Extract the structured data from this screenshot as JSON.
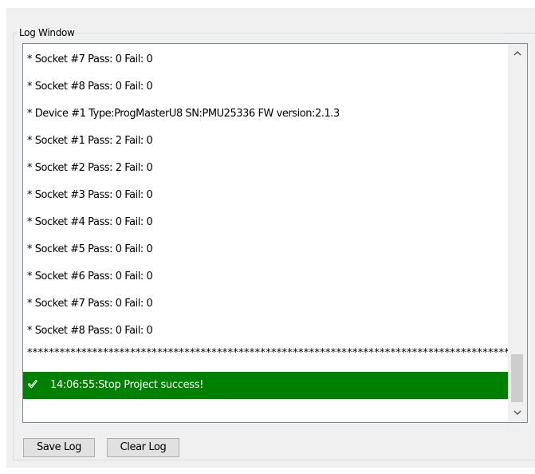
{
  "log_window": {
    "title": "Log Window",
    "lines": [
      {
        "text": "*  Socket #7 Pass: 0 Fail: 0",
        "type": "info"
      },
      {
        "text": "*  Socket #8 Pass: 0 Fail: 0",
        "type": "info"
      },
      {
        "text": "*  Device #1 Type:ProgMasterU8 SN:PMU25336 FW version:2.1.3",
        "type": "info"
      },
      {
        "text": "*  Socket #1 Pass: 2 Fail: 0",
        "type": "info"
      },
      {
        "text": "*  Socket #2 Pass: 2 Fail: 0",
        "type": "info"
      },
      {
        "text": "*  Socket #3 Pass: 0 Fail: 0",
        "type": "info"
      },
      {
        "text": "*  Socket #4 Pass: 0 Fail: 0",
        "type": "info"
      },
      {
        "text": "*  Socket #5 Pass: 0 Fail: 0",
        "type": "info"
      },
      {
        "text": "*  Socket #6 Pass: 0 Fail: 0",
        "type": "info"
      },
      {
        "text": "*  Socket #7 Pass: 0 Fail: 0",
        "type": "info"
      },
      {
        "text": "*  Socket #8 Pass: 0 Fail: 0",
        "type": "info"
      },
      {
        "text": "**************************************************************************************************",
        "type": "separator"
      },
      {
        "text": "14:06:55:Stop Project success!",
        "type": "success",
        "icon": "checkmark-icon"
      }
    ],
    "scrollbar": {
      "up_icon": "chevron-up-icon",
      "down_icon": "chevron-down-icon"
    }
  },
  "buttons": {
    "save_label": "Save Log",
    "clear_label": "Clear Log"
  },
  "colors": {
    "success_bg": "#008000",
    "success_text": "#ffffff",
    "panel_bg": "#f0f0f0",
    "button_bg": "#e1e1e1"
  }
}
